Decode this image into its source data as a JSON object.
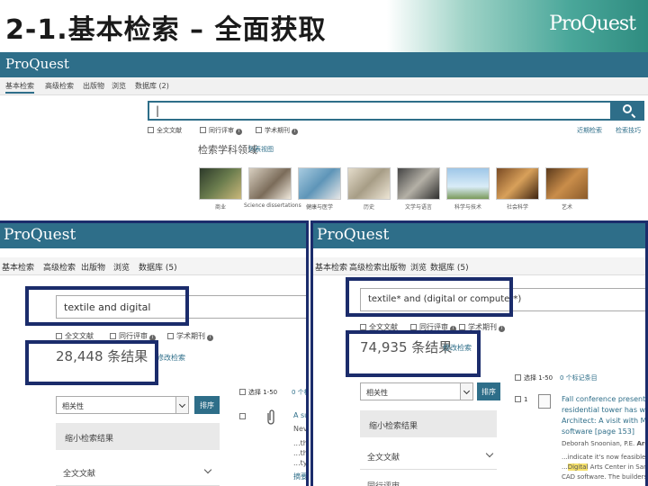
{
  "slide": {
    "title": "2-1.基本检索 – 全面获取",
    "logo": "ProQuest"
  },
  "main_screenshot": {
    "logo": "ProQuest",
    "nav": [
      "基本检索",
      "高级检索",
      "出版物",
      "浏览",
      "数据库 (2)"
    ],
    "search": {
      "value": "|",
      "placeholder": ""
    },
    "options": [
      "全文文献",
      "同行评审",
      "学术期刊"
    ],
    "links": [
      "近期检索",
      "检索技巧"
    ],
    "subjects": {
      "title": "检索学科领域",
      "link": "列表视图",
      "items": [
        "商业",
        "Science dissertations",
        "健康与医学",
        "历史",
        "文学与语言",
        "科学与技术",
        "社会科学",
        "艺术"
      ]
    }
  },
  "left_panel": {
    "logo": "ProQuest",
    "nav": [
      "基本检索",
      "高级检索",
      "出版物",
      "浏览",
      "数据库 (5)"
    ],
    "query": "textile and digital",
    "options": [
      "全文文献",
      "同行评审",
      "学术期刊"
    ],
    "result_count": "28,448 条结果",
    "modify": "修改检索",
    "sort": {
      "value": "相关性",
      "button": "排序"
    },
    "select": "选择 1-50",
    "selected": "0 个标",
    "facet_header": "缩小检索结果",
    "facets": [
      "全文文献"
    ],
    "result_snippets": [
      "A sur",
      "Nev",
      "...tha",
      "...tha",
      "...typ",
      "摘要"
    ]
  },
  "right_panel": {
    "logo": "ProQuest",
    "nav": [
      "基本检索",
      "高级检索",
      "出版物",
      "浏览",
      "数据库 (5)"
    ],
    "query": "textile* and (digital or computer*)",
    "options": [
      "全文文献",
      "同行评审",
      "学术期刊"
    ],
    "result_count": "74,935 条结果",
    "modify": "修改检索",
    "sort": {
      "value": "相关性",
      "button": "排序"
    },
    "select": "选择 1-50",
    "selected": "0 个标记条目",
    "facet_header": "缩小检索结果",
    "facets": [
      "全文文献",
      "同行评审"
    ],
    "result": {
      "title_lines": [
        "Fall conference presents new o",
        "residential tower has wireless",
        "Architect: A visit with Masters",
        "software [page 153]"
      ],
      "author": "Deborah Snoonian, P.E.",
      "author_extra": "Architectur",
      "snippet_lines": [
        "...indicate it's now feasible for firm",
        "Arts Center in San Franci",
        "CAD software. The builders are"
      ],
      "snippet_pre": "...",
      "highlight": "Digital"
    }
  },
  "colors": {
    "brand": "#2e6e89",
    "highlight_border": "#1b2c6b",
    "header_gradient_end": "#2f8c80"
  }
}
